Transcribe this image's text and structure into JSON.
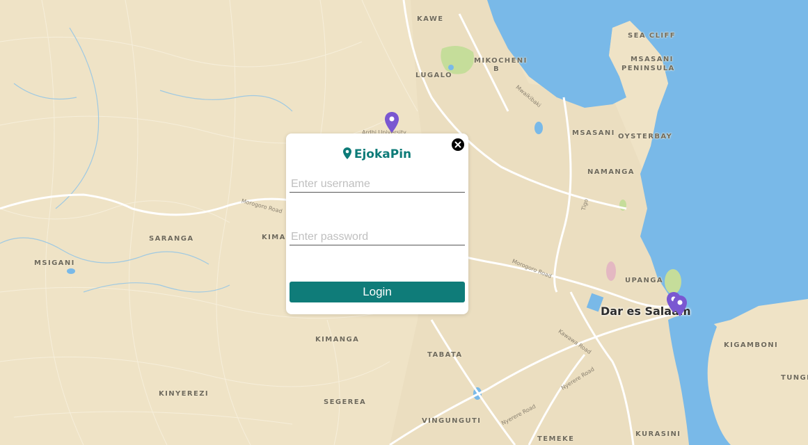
{
  "map": {
    "places": [
      {
        "name": "KAWE"
      },
      {
        "name": "SEA CLIFF"
      },
      {
        "name": "MSASANI"
      },
      {
        "name": "PENINSULA"
      },
      {
        "name": "MIKOCHENI"
      },
      {
        "name": "B"
      },
      {
        "name": "LUGALO"
      },
      {
        "name": "MSASANI"
      },
      {
        "name": "OYSTERBAY"
      },
      {
        "name": "NAMANGA"
      },
      {
        "name": "SARANGA"
      },
      {
        "name": "KIMAR"
      },
      {
        "name": "MSIGANI"
      },
      {
        "name": "UPANGA"
      },
      {
        "name": "KIMANGA"
      },
      {
        "name": "TABATA"
      },
      {
        "name": "KIGAMBONI"
      },
      {
        "name": "TUNGI"
      },
      {
        "name": "KINYEREZI"
      },
      {
        "name": "SEGEREA"
      },
      {
        "name": "VINGUNGUTI"
      },
      {
        "name": "TEMEKE"
      },
      {
        "name": "KURASINI"
      }
    ],
    "city": "Dar es Salaam",
    "roads": [
      "Morogoro Road",
      "Morogoro Road",
      "Kawawa Road",
      "Nyerere Road",
      "Nyerere Road",
      "Mwaikibaki",
      "Tigo",
      "Ardhi University"
    ],
    "colors": {
      "land": "#efe3c6",
      "water": "#79b9e8",
      "park": "#c5dd9a",
      "marker": "#7a57d1"
    }
  },
  "login": {
    "brand": "EjokaPin",
    "username_placeholder": "Enter username",
    "password_placeholder": "Enter password",
    "login_label": "Login",
    "accent": "#0f7c79"
  }
}
